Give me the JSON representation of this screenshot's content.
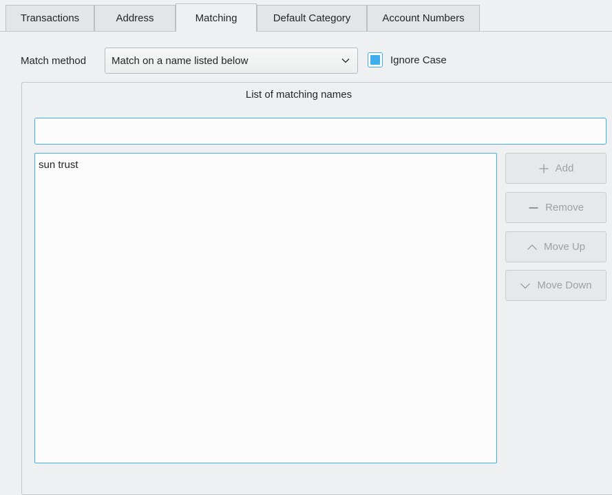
{
  "tabs": [
    {
      "label": "Transactions",
      "active": false
    },
    {
      "label": "Address",
      "active": false
    },
    {
      "label": "Matching",
      "active": true
    },
    {
      "label": "Default Category",
      "active": false
    },
    {
      "label": "Account Numbers",
      "active": false
    }
  ],
  "match": {
    "label": "Match method",
    "selected": "Match on a name listed below",
    "ignore_case_label": "Ignore Case",
    "ignore_case_checked": true
  },
  "names_group": {
    "title": "List of matching names",
    "input_value": "",
    "items": [
      "sun trust"
    ]
  },
  "buttons": {
    "add": "Add",
    "remove": "Remove",
    "move_up": "Move Up",
    "move_down": "Move Down"
  },
  "icons": {
    "add": "plus-icon",
    "remove": "minus-icon",
    "move_up": "chevron-up-icon",
    "move_down": "chevron-down-icon",
    "select": "chevron-down-icon"
  },
  "colors": {
    "accent": "#3daee9",
    "background": "#eff0f1",
    "disabled_text": "#9da1a4"
  }
}
